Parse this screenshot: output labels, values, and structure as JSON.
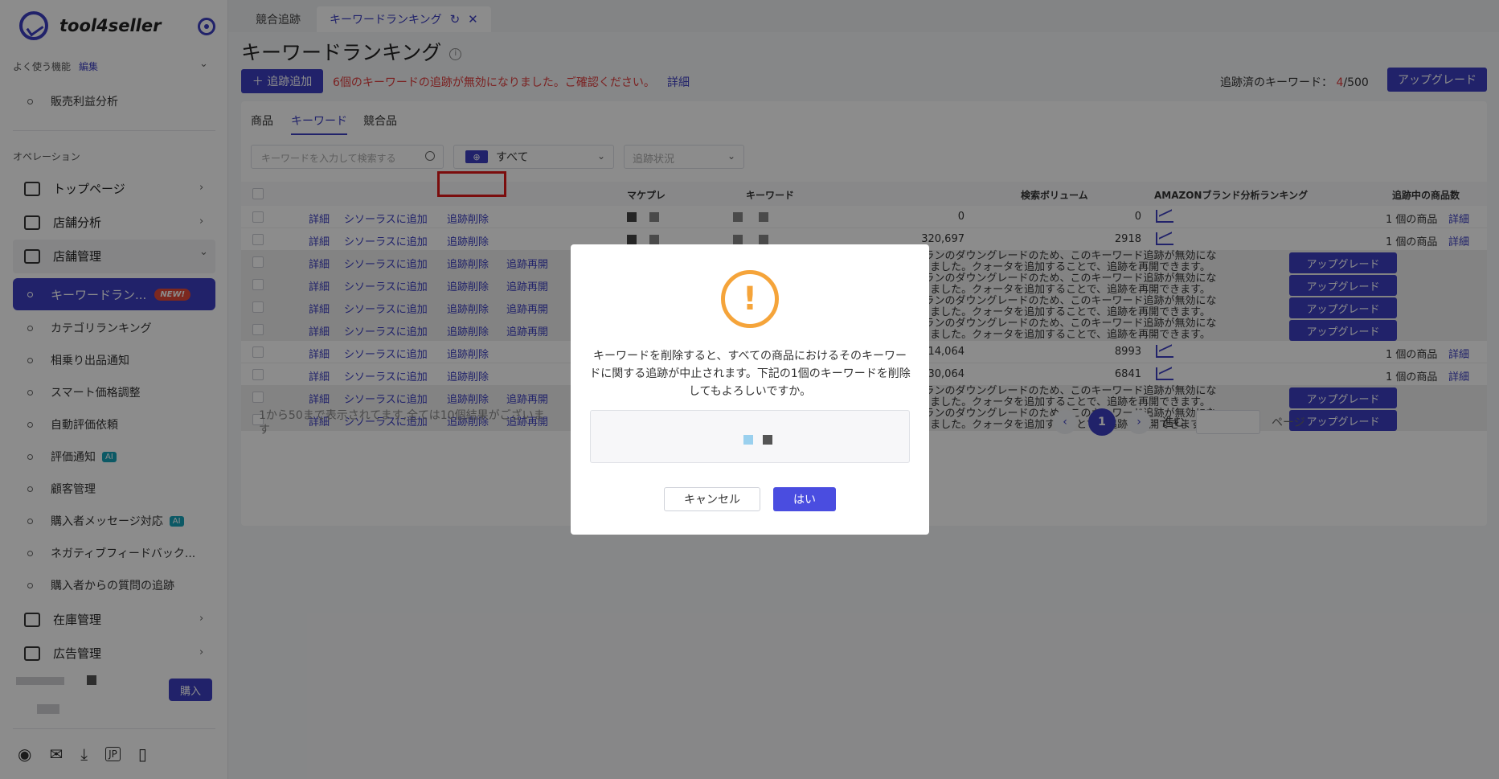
{
  "app": {
    "brand": "tool4seller"
  },
  "sidebar": {
    "favorites_label": "よく使う機能",
    "favorites_edit": "編集",
    "favorites_items": [
      "販売利益分析"
    ],
    "operations_label": "オペレーション",
    "groups": [
      {
        "label": "トップページ",
        "icon": "home-icon"
      },
      {
        "label": "店舗分析",
        "icon": "chart-icon"
      },
      {
        "label": "店舗管理",
        "icon": "store-icon"
      }
    ],
    "store_items": [
      {
        "label": "キーワードラン...",
        "badge": "NEW!",
        "active": true
      },
      {
        "label": "カテゴリランキング"
      },
      {
        "label": "相乗り出品通知"
      },
      {
        "label": "スマート価格調整"
      },
      {
        "label": "自動評価依頼"
      },
      {
        "label": "評価通知",
        "badge": "AI"
      },
      {
        "label": "顧客管理"
      },
      {
        "label": "購入者メッセージ対応",
        "badge": "AI"
      },
      {
        "label": "ネガティブフィードバック..."
      },
      {
        "label": "購入者からの質問の追跡"
      }
    ],
    "more_groups": [
      {
        "label": "在庫管理",
        "icon": "inventory-icon"
      },
      {
        "label": "広告管理",
        "icon": "monitor-icon"
      }
    ],
    "buy_label": "購入",
    "bottom_icons": [
      "user-icon",
      "mail-icon",
      "download-icon",
      "jp-icon",
      "phone-icon"
    ]
  },
  "tabs": [
    {
      "label": "競合追跡"
    },
    {
      "label": "キーワードランキング",
      "active": true
    }
  ],
  "header": {
    "title": "キーワードランキング",
    "add_button": "＋ 追跡追加",
    "warning": "6個のキーワードの追跡が無効になりました。ご確認ください。",
    "warning_link": "詳細",
    "tracked_label": "追跡済のキーワード：",
    "tracked_used": "4",
    "tracked_total": "/500",
    "upgrade_button": "アップグレード"
  },
  "subtabs": [
    "商品",
    "キーワード",
    "競合品"
  ],
  "filters": {
    "search_placeholder": "キーワードを入力して検索する",
    "marketplace_value": "すべて",
    "status_placeholder": "追跡状況"
  },
  "table": {
    "headers": {
      "market": "マケプレ",
      "keyword": "キーワード",
      "volume": "検索ボリューム",
      "brand_rank": "AMAZONブランド分析ランキング",
      "products": "追跡中の商品数"
    },
    "actions": {
      "detail": "詳細",
      "thesaurus": "シソーラスに追加",
      "delete": "追跡削除",
      "resume": "追跡再開"
    },
    "disabled_message_1": "プランのダウングレードのため、このキーワード追跡が無効にな",
    "disabled_message_2": "りました。クォータを追加することで、追跡を再開できます。",
    "upgrade_label": "アップグレード",
    "rows": [
      {
        "disabled": false,
        "volume": "0",
        "rank": "0",
        "count": "1 個の商品",
        "detail": "詳細"
      },
      {
        "disabled": false,
        "volume": "320,697",
        "rank": "2918",
        "count": "1 個の商品",
        "detail": "詳細"
      },
      {
        "disabled": true
      },
      {
        "disabled": true
      },
      {
        "disabled": true
      },
      {
        "disabled": true
      },
      {
        "disabled": false,
        "volume": "14,064",
        "rank": "8993",
        "count": "1 個の商品",
        "detail": "詳細"
      },
      {
        "disabled": false,
        "volume": "30,064",
        "rank": "6841",
        "count": "1 個の商品",
        "detail": "詳細"
      },
      {
        "disabled": true
      },
      {
        "disabled": true
      }
    ]
  },
  "footer": {
    "summary": "1から50まで表示されてます,全ては10個結果がございます",
    "current_page": "1",
    "goto_label": "進む",
    "page_label": "ページ"
  },
  "modal": {
    "message": "キーワードを削除すると、すべての商品におけるそのキーワードに関する追跡が中止されます。下記の1個のキーワードを削除してもよろしいですか。",
    "cancel": "キャンセル",
    "confirm": "はい"
  },
  "colors": {
    "primary": "#3c3fc2",
    "warning": "#f5a43a",
    "danger": "#e03c3c"
  }
}
